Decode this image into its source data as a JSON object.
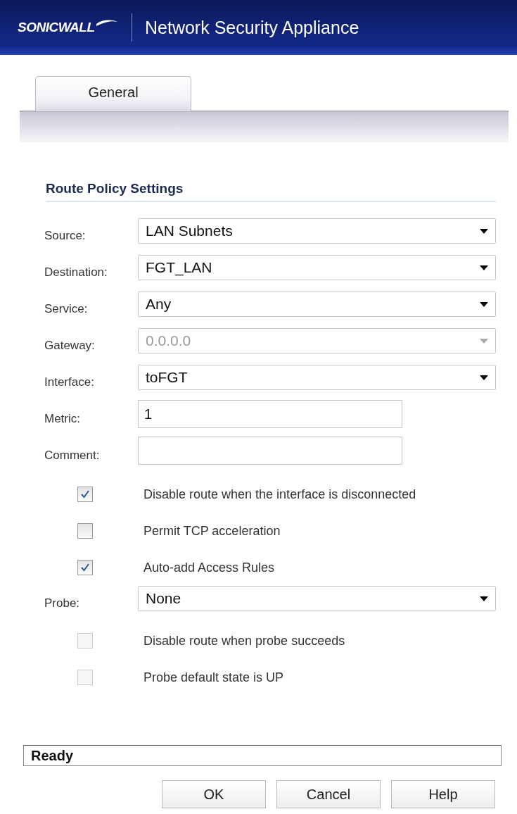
{
  "header": {
    "logo": "SONICWALL",
    "title": "Network Security Appliance"
  },
  "tabs": [
    {
      "label": "General",
      "selected": true
    }
  ],
  "section_title": "Route Policy Settings",
  "fields": [
    {
      "kind": "select",
      "label": "Source:",
      "value": "LAN Subnets",
      "disabled": false
    },
    {
      "kind": "select",
      "label": "Destination:",
      "value": "FGT_LAN",
      "disabled": false
    },
    {
      "kind": "select",
      "label": "Service:",
      "value": "Any",
      "disabled": false
    },
    {
      "kind": "select",
      "label": "Gateway:",
      "value": "0.0.0.0",
      "disabled": true
    },
    {
      "kind": "select",
      "label": "Interface:",
      "value": "toFGT",
      "disabled": false
    },
    {
      "kind": "text",
      "label": "Metric:",
      "value": "1"
    },
    {
      "kind": "text",
      "label": "Comment:"
    },
    {
      "kind": "checkbox",
      "label": "Disable route when the interface is disconnected",
      "checked": true,
      "disabled": false
    },
    {
      "kind": "checkbox",
      "label": "Permit TCP acceleration",
      "checked": false,
      "disabled": false
    },
    {
      "kind": "checkbox",
      "label": "Auto-add Access Rules",
      "checked": true,
      "disabled": false
    },
    {
      "kind": "select",
      "label": "Probe:",
      "value": "None",
      "disabled": false
    },
    {
      "kind": "checkbox",
      "label": "Disable route when probe succeeds",
      "checked": false,
      "disabled": true
    },
    {
      "kind": "checkbox",
      "label": "Probe default state is UP",
      "checked": false,
      "disabled": true
    }
  ],
  "status_bar": "Ready",
  "buttons": [
    "OK",
    "Cancel",
    "Help"
  ]
}
